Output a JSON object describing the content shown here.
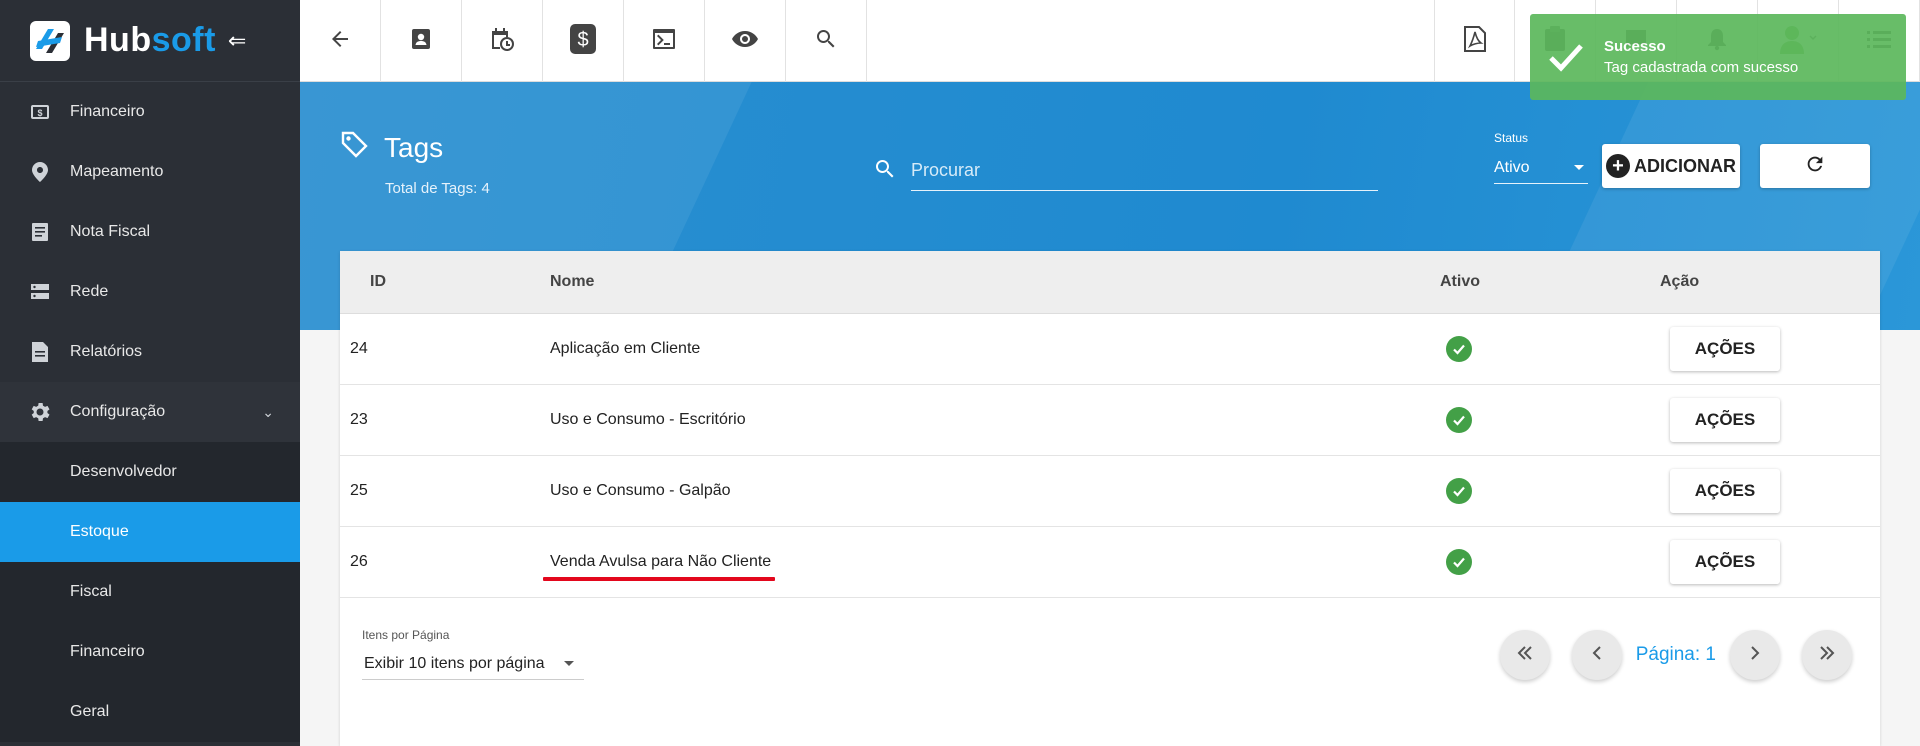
{
  "brand": {
    "name_part1": "Hub",
    "name_part2": "soft",
    "collapse_icon": "menu-collapse-icon"
  },
  "sidebar": {
    "items": [
      {
        "label": "Financeiro",
        "icon": "money-icon"
      },
      {
        "label": "Mapeamento",
        "icon": "map-pin-icon"
      },
      {
        "label": "Nota Fiscal",
        "icon": "receipt-icon"
      },
      {
        "label": "Rede",
        "icon": "server-icon"
      },
      {
        "label": "Relatórios",
        "icon": "report-icon"
      },
      {
        "label": "Configuração",
        "icon": "gear-icon",
        "expanded": true
      }
    ],
    "subitems": [
      {
        "label": "Desenvolvedor",
        "active": false
      },
      {
        "label": "Estoque",
        "active": true
      },
      {
        "label": "Fiscal",
        "active": false
      },
      {
        "label": "Financeiro",
        "active": false
      },
      {
        "label": "Geral",
        "active": false
      }
    ]
  },
  "topbar": {
    "icons": [
      "back-arrow-icon",
      "contact-card-icon",
      "calendar-clock-icon",
      "dollar-icon",
      "terminal-icon",
      "eye-icon",
      "search-icon"
    ],
    "right_icons": [
      "pdf-icon",
      "clipboard-icon",
      "chat-icon",
      "bell-icon",
      "user-avatar-icon",
      "list-icon"
    ]
  },
  "toast": {
    "title": "Sucesso",
    "message": "Tag cadastrada com sucesso",
    "color": "#5cb85c"
  },
  "header": {
    "title": "Tags",
    "subtitle": "Total de Tags: 4",
    "search_placeholder": "Procurar",
    "status_label": "Status",
    "status_value": "Ativo",
    "add_label": "ADICIONAR"
  },
  "table": {
    "columns": {
      "id": "ID",
      "name": "Nome",
      "active": "Ativo",
      "action": "Ação"
    },
    "rows": [
      {
        "id": "24",
        "name": "Aplicação em Cliente",
        "active": true,
        "action": "AÇÕES"
      },
      {
        "id": "23",
        "name": "Uso e Consumo - Escritório",
        "active": true,
        "action": "AÇÕES"
      },
      {
        "id": "25",
        "name": "Uso e Consumo - Galpão",
        "active": true,
        "action": "AÇÕES"
      },
      {
        "id": "26",
        "name": "Venda Avulsa para Não Cliente",
        "active": true,
        "action": "AÇÕES",
        "highlighted": true
      }
    ]
  },
  "footer": {
    "items_per_page_label": "Itens por Página",
    "items_per_page_value": "Exibir 10 itens por página",
    "page_label": "Página: 1"
  },
  "colors": {
    "accent": "#1a9be8",
    "sidebar": "#2b2f36",
    "success": "#43a047",
    "highlight": "#e3071d"
  }
}
